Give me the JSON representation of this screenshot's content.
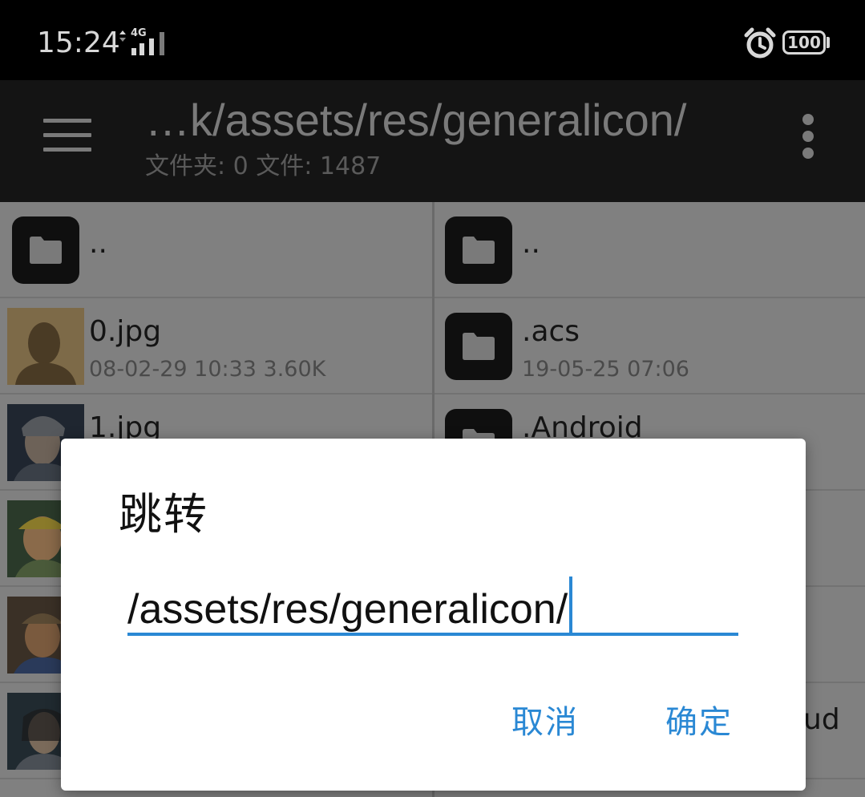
{
  "status_bar": {
    "time": "15:24",
    "network": "4G",
    "battery": "100",
    "alarm_icon": "alarm-clock-icon"
  },
  "toolbar": {
    "menu_icon": "hamburger-menu-icon",
    "title": "…k/assets/res/generalicon/",
    "subtitle": "文件夹: 0  文件: 1487",
    "overflow_icon": "more-vertical-icon"
  },
  "left_pane": {
    "items": [
      {
        "name": "..",
        "meta": "",
        "kind": "folder"
      },
      {
        "name": "0.jpg",
        "meta": "08-02-29 10:33  3.60K",
        "kind": "image"
      },
      {
        "name": "1.jpg",
        "meta": "",
        "kind": "image"
      },
      {
        "name": "",
        "meta": "",
        "kind": "image"
      },
      {
        "name": "",
        "meta": "",
        "kind": "image"
      },
      {
        "name": "",
        "meta": "",
        "kind": "image"
      }
    ]
  },
  "right_pane": {
    "items": [
      {
        "name": "..",
        "meta": "",
        "kind": "folder"
      },
      {
        "name": ".acs",
        "meta": "19-05-25 07:06",
        "kind": "folder"
      },
      {
        "name": ".Android",
        "meta": "",
        "kind": "folder"
      },
      {
        "name": "ud",
        "meta": "",
        "kind": "partial"
      }
    ]
  },
  "dialog": {
    "title": "跳转",
    "input_value": "/assets/res/generalicon/",
    "cancel_label": "取消",
    "ok_label": "确定",
    "accent_color": "#2a88d4"
  }
}
